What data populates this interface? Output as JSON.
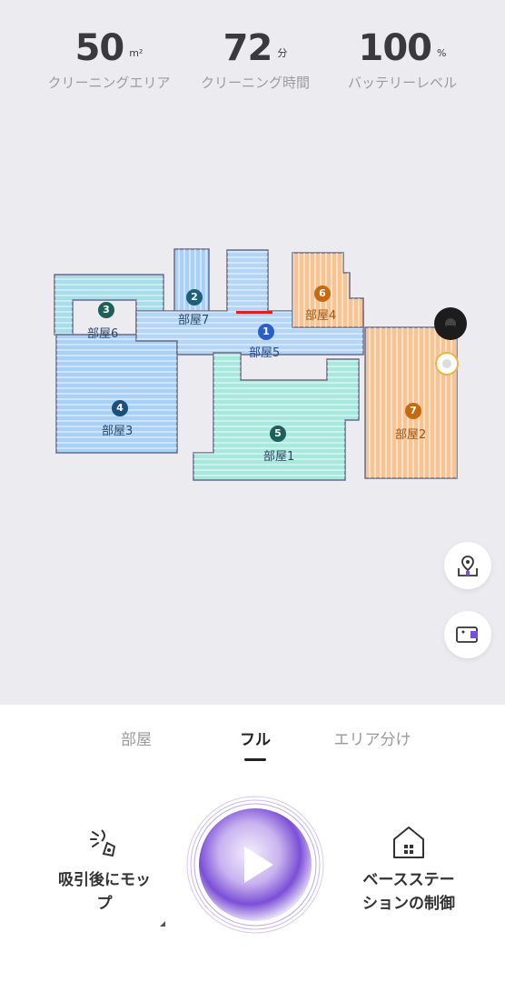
{
  "stats": {
    "area": {
      "value": "50",
      "unit": "m²",
      "label": "クリーニングエリア"
    },
    "time": {
      "value": "72",
      "unit": "分",
      "label": "クリーニング時間"
    },
    "battery": {
      "value": "100",
      "unit": "%",
      "label": "バッテリーレベル"
    }
  },
  "rooms": [
    {
      "num": "1",
      "name": "部屋5"
    },
    {
      "num": "2",
      "name": "部屋7"
    },
    {
      "num": "3",
      "name": "部屋6"
    },
    {
      "num": "4",
      "name": "部屋3"
    },
    {
      "num": "5",
      "name": "部屋1"
    },
    {
      "num": "6",
      "name": "部屋4"
    },
    {
      "num": "7",
      "name": "部屋2"
    }
  ],
  "tabs": [
    {
      "label": "部屋"
    },
    {
      "label": "フル"
    },
    {
      "label": "エリア分け"
    }
  ],
  "actions": {
    "mode_line1": "吸引後にモッ",
    "mode_line2": "プ",
    "station_line1": "ベースステー",
    "station_line2": "ションの制御"
  },
  "icons": {
    "map_edit": "map-pin-icon",
    "camera": "camera-icon",
    "mode": "vacuum-mop-icon",
    "station": "base-station-icon",
    "play": "play-icon",
    "robot": "robot-icon",
    "dock": "dock-icon"
  },
  "colors": {
    "blue_room": "#a9d0f5",
    "teal_room": "#a8e8df",
    "orange_room": "#f5c596",
    "accent_purple": "#7b4fd6"
  }
}
